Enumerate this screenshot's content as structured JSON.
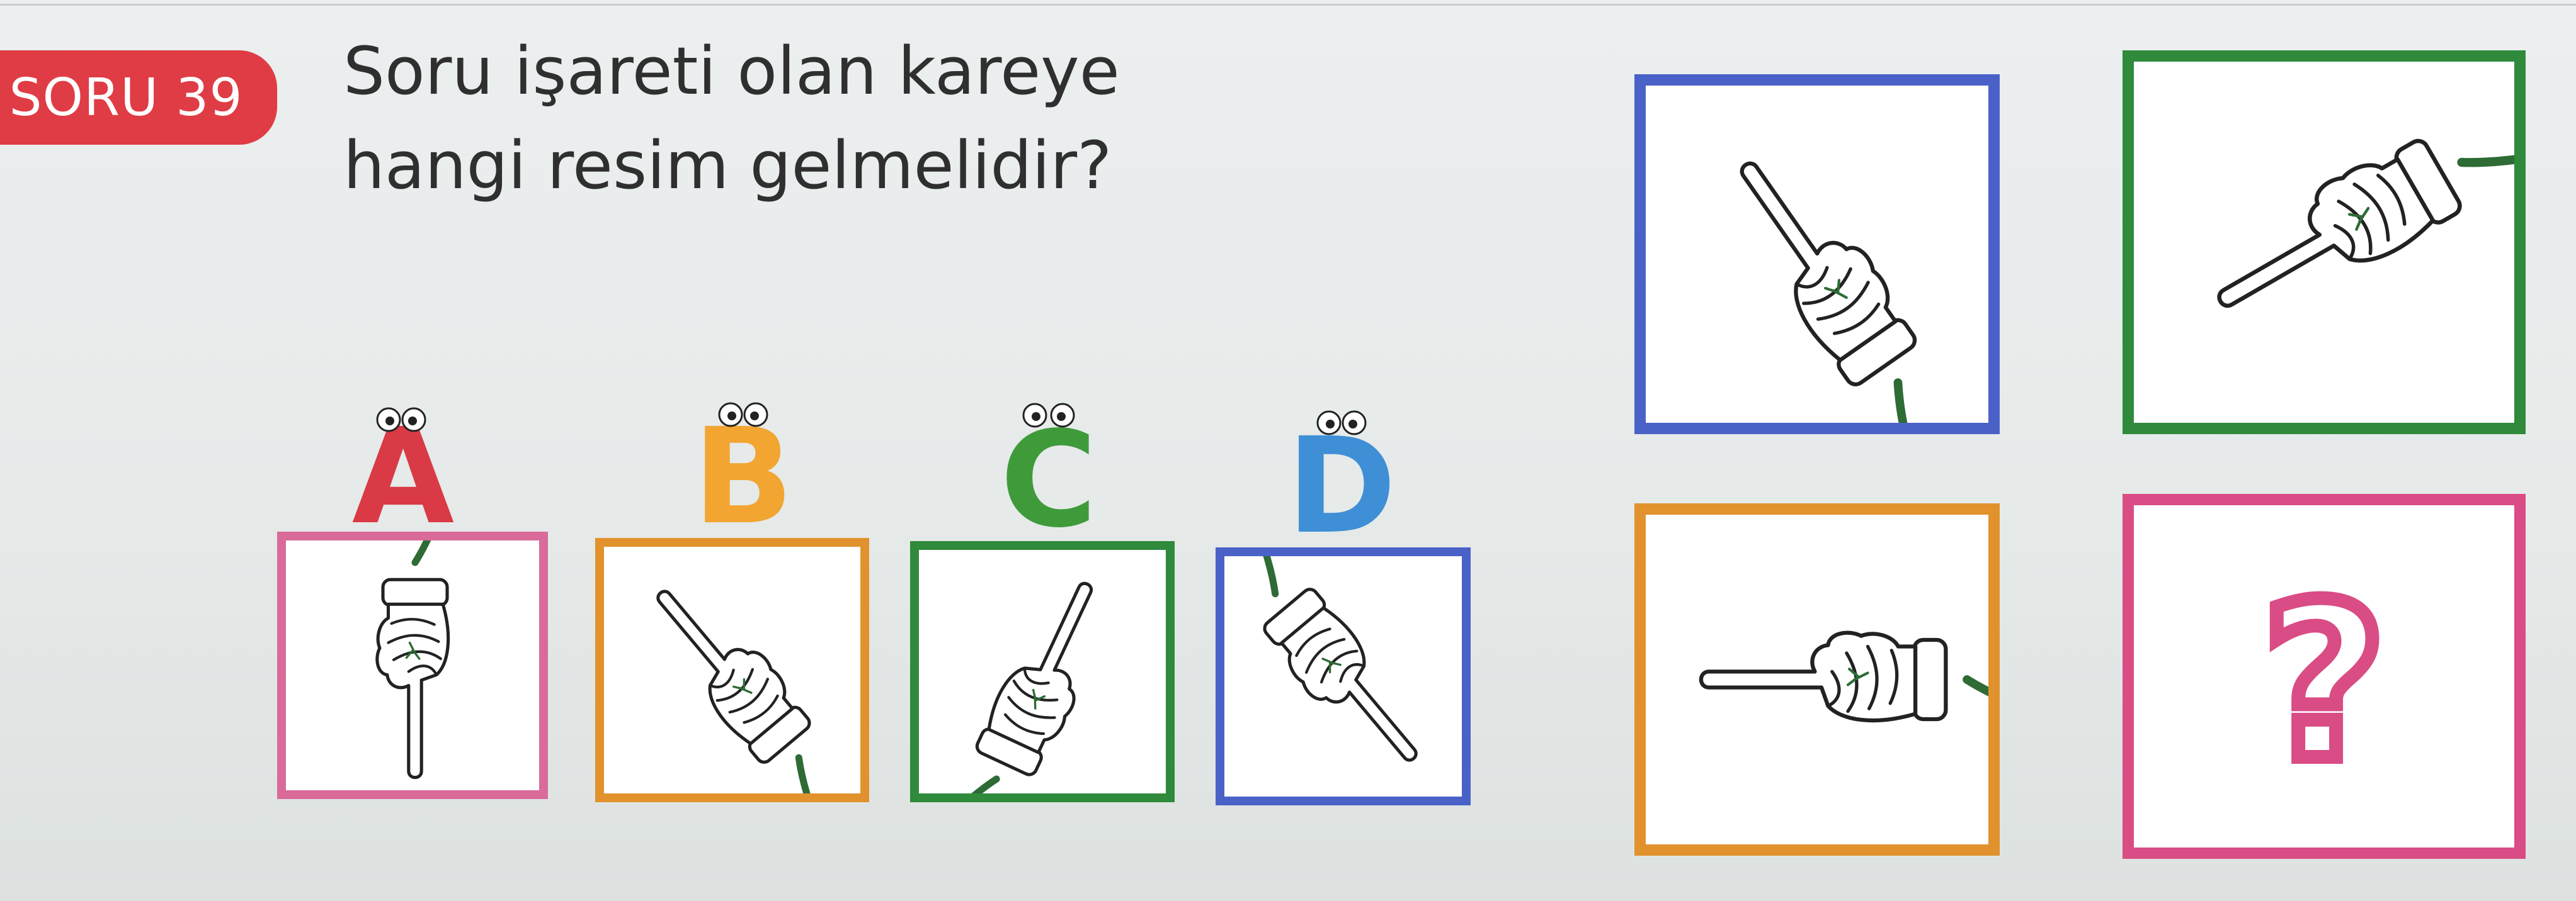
{
  "badge": {
    "label": "SORU 39",
    "color": "#e03c45"
  },
  "question": {
    "line1": "Soru işareti olan kareye",
    "line2": "hangi resim gelmelidir?"
  },
  "pattern_cells": [
    {
      "id": "top-left",
      "border_color": "#4a62c8",
      "icon": "hand-pointing-up-left-icon"
    },
    {
      "id": "top-right",
      "border_color": "#2f8a3c",
      "icon": "hand-pointing-down-left-icon"
    },
    {
      "id": "bottom-left",
      "border_color": "#e1922c",
      "icon": "hand-pointing-left-icon"
    },
    {
      "id": "bottom-right",
      "border_color": "#d94c85",
      "icon": "question-mark-icon",
      "symbol": "?"
    }
  ],
  "options": [
    {
      "letter": "A",
      "letter_color": "#d93a45",
      "border_color": "#d96a9a",
      "icon": "hand-pointing-down-icon"
    },
    {
      "letter": "B",
      "letter_color": "#f2a531",
      "border_color": "#e1922c",
      "icon": "hand-pointing-up-left-icon"
    },
    {
      "letter": "C",
      "letter_color": "#3f9b3a",
      "border_color": "#2f8a3c",
      "icon": "hand-pointing-up-right-icon"
    },
    {
      "letter": "D",
      "letter_color": "#3f8fd6",
      "border_color": "#4a62c8",
      "icon": "hand-pointing-down-right-icon"
    }
  ]
}
